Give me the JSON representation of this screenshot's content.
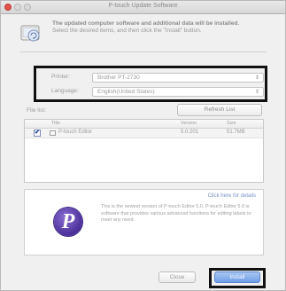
{
  "window": {
    "title": "P-touch Update Software"
  },
  "header": {
    "title": "The updated computer software and additional data will be installed.",
    "instruction": "Select the desired items, and then click the \"Install\" button."
  },
  "settings": {
    "printer_label": "Printer:",
    "printer_value": "Brother PT-2730",
    "language_label": "Language:",
    "language_value": "English(United States)"
  },
  "file_list": {
    "label": "File list:",
    "refresh_label": "Refresh List",
    "columns": {
      "title": "Title",
      "version": "Version",
      "size": "Size"
    },
    "rows": [
      {
        "checked": true,
        "check_glyph": "✔",
        "title": "P-touch Editor",
        "version": "5.0.201",
        "size": "51.7MB"
      }
    ]
  },
  "info": {
    "link": "Click here for details",
    "description": "This is the newest version of P-touch Editor 5.0. P-touch Editor 5.0 is software that provides various advanced functions for editing labels to meet any need.",
    "logo_letter": "P",
    "logo_color": "#4a2f9a"
  },
  "footer": {
    "close_label": "Close",
    "install_label": "Install"
  },
  "colors": {
    "accent": "#6f9ee6",
    "highlight_border": "#111111"
  }
}
